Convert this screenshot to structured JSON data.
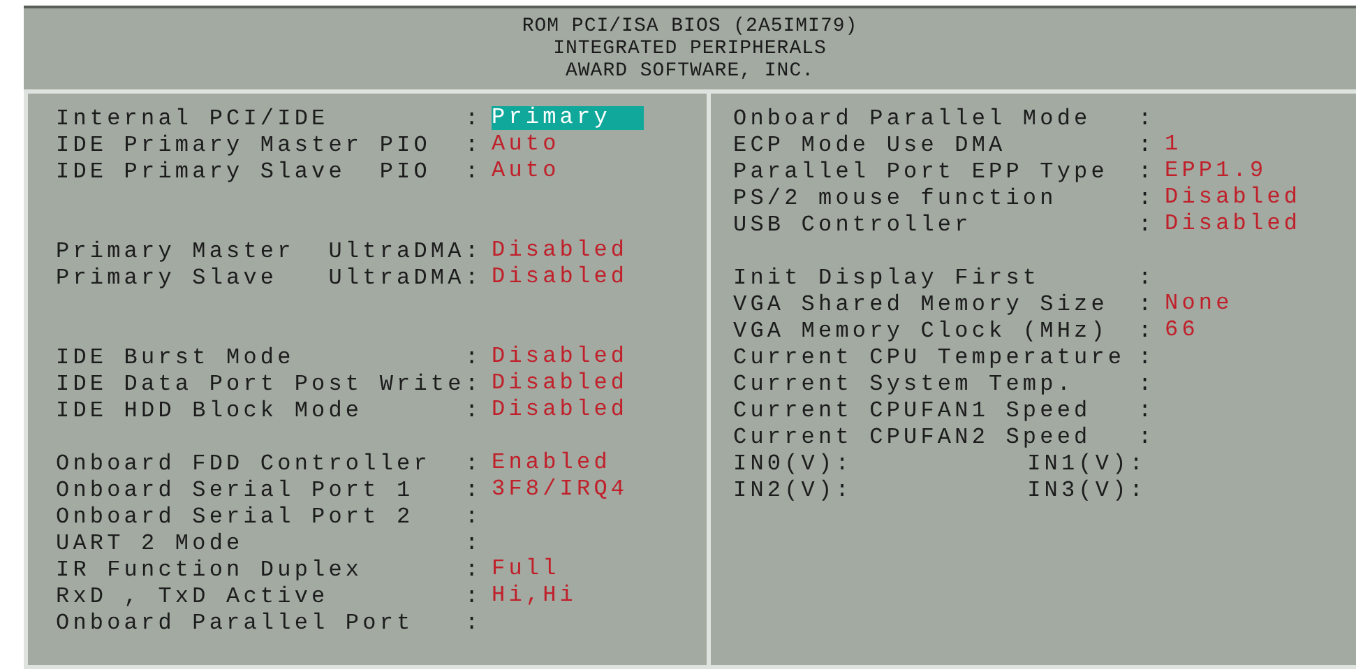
{
  "header": {
    "lines": [
      "ROM PCI/ISA BIOS (2A5IMI79)",
      "INTEGRATED PERIPHERALS",
      "AWARD SOFTWARE, INC."
    ]
  },
  "columns": [
    {
      "rows": [
        {
          "kind": "setting",
          "label": "Internal PCI/IDE",
          "sep": ":",
          "value": "Primary",
          "selected": true
        },
        {
          "kind": "setting",
          "label": "IDE Primary Master PIO",
          "sep": ":",
          "value": "Auto",
          "selected": false
        },
        {
          "kind": "setting",
          "label": "IDE Primary Slave  PIO",
          "sep": ":",
          "value": "Auto",
          "selected": false
        },
        {
          "kind": "blank"
        },
        {
          "kind": "blank"
        },
        {
          "kind": "setting",
          "label": "Primary Master  UltraDMA",
          "sep": ":",
          "value": "Disabled",
          "selected": false
        },
        {
          "kind": "setting",
          "label": "Primary Slave   UltraDMA",
          "sep": ":",
          "value": "Disabled",
          "selected": false
        },
        {
          "kind": "blank"
        },
        {
          "kind": "blank"
        },
        {
          "kind": "setting",
          "label": "IDE Burst Mode",
          "sep": ":",
          "value": "Disabled",
          "selected": false
        },
        {
          "kind": "setting",
          "label": "IDE Data Port Post Write",
          "sep": ":",
          "value": "Disabled",
          "selected": false
        },
        {
          "kind": "setting",
          "label": "IDE HDD Block Mode",
          "sep": ":",
          "value": "Disabled",
          "selected": false
        },
        {
          "kind": "blank"
        },
        {
          "kind": "setting",
          "label": "Onboard FDD Controller",
          "sep": ":",
          "value": "Enabled",
          "selected": false
        },
        {
          "kind": "setting",
          "label": "Onboard Serial Port 1",
          "sep": ":",
          "value": "3F8/IRQ4",
          "selected": false
        },
        {
          "kind": "setting",
          "label": "Onboard Serial Port 2",
          "sep": ":"
        },
        {
          "kind": "setting",
          "label": "UART 2 Mode",
          "sep": ":"
        },
        {
          "kind": "setting",
          "label": "IR Function Duplex",
          "sep": ":",
          "value": "Full",
          "selected": false
        },
        {
          "kind": "setting",
          "label": "RxD , TxD Active",
          "sep": ":",
          "value": "Hi,Hi",
          "selected": false
        },
        {
          "kind": "setting",
          "label": "Onboard Parallel Port",
          "sep": ":"
        }
      ]
    },
    {
      "rows": [
        {
          "kind": "setting",
          "label": "Onboard Parallel Mode",
          "sep": ":"
        },
        {
          "kind": "setting",
          "label": "ECP Mode Use DMA",
          "sep": ":",
          "value": "1",
          "selected": false
        },
        {
          "kind": "setting",
          "label": "Parallel Port EPP Type",
          "sep": ":",
          "value": "EPP1.9",
          "selected": false
        },
        {
          "kind": "setting",
          "label": "PS/2 mouse function",
          "sep": ":",
          "value": "Disabled",
          "selected": false
        },
        {
          "kind": "setting",
          "label": "USB Controller",
          "sep": ":",
          "value": "Disabled",
          "selected": false
        },
        {
          "kind": "blank"
        },
        {
          "kind": "setting",
          "label": "Init Display First",
          "sep": ":"
        },
        {
          "kind": "setting",
          "label": "VGA Shared Memory Size",
          "sep": ":",
          "value": "None",
          "selected": false
        },
        {
          "kind": "setting",
          "label": "VGA Memory Clock (MHz)",
          "sep": ":",
          "value": "66",
          "selected": false
        },
        {
          "kind": "setting",
          "label": "Current CPU Temperature",
          "sep": ":"
        },
        {
          "kind": "setting",
          "label": "Current System Temp.",
          "sep": ":"
        },
        {
          "kind": "setting",
          "label": "Current CPUFAN1 Speed",
          "sep": ":"
        },
        {
          "kind": "setting",
          "label": "Current CPUFAN2 Speed",
          "sep": ":"
        },
        {
          "kind": "pair",
          "left": "IN0(V):",
          "right": "IN1(V):"
        },
        {
          "kind": "pair",
          "left": "IN2(V):",
          "right": "IN3(V):"
        }
      ]
    }
  ]
}
